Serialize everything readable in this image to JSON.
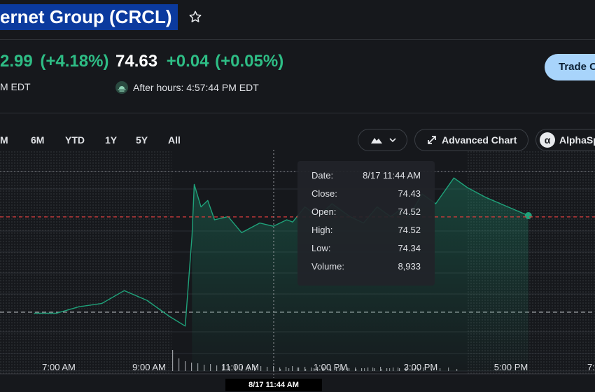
{
  "header": {
    "title": "ernet Group (CRCL)",
    "favorite_icon": "star-outline-icon"
  },
  "quote": {
    "regular_change_partial": "2.99",
    "regular_change_percent": "(+4.18%)",
    "regular_time_partial": "M EDT",
    "after_hours_price": "74.63",
    "after_hours_change": "+0.04",
    "after_hours_change_percent": "(+0.05%)",
    "after_hours_icon": "moon-sunset-icon",
    "after_hours_label": "After hours: 4:57:44 PM EDT"
  },
  "actions": {
    "trade_button": "Trade C"
  },
  "range_tabs": [
    "M",
    "6M",
    "YTD",
    "1Y",
    "5Y",
    "All"
  ],
  "toolbar": {
    "chart_type_icon": "mountain-chart-icon",
    "dropdown_icon": "chevron-down-icon",
    "advanced_chart_icon": "expand-arrows-icon",
    "advanced_chart_label": "Advanced Chart",
    "alphaspread_icon": "alpha-logo-icon",
    "alphaspread_label": "AlphaSp"
  },
  "tooltip": {
    "rows": [
      {
        "label": "Date:",
        "value": "8/17 11:44 AM"
      },
      {
        "label": "Close:",
        "value": "74.43"
      },
      {
        "label": "Open:",
        "value": "74.52"
      },
      {
        "label": "High:",
        "value": "74.52"
      },
      {
        "label": "Low:",
        "value": "74.34"
      },
      {
        "label": "Volume:",
        "value": "8,933"
      }
    ]
  },
  "crosshair_label": "8/17 11:44 AM",
  "colors": {
    "up": "#2ebd85",
    "reference_line": "#d63b3b",
    "highlight": "#0b3a9e",
    "trade_button": "#a8d4fb"
  },
  "chart_data": {
    "type": "area",
    "x_tick_labels": [
      "7:00 AM",
      "9:00 AM",
      "11:00 AM",
      "1:00 PM",
      "3:00 PM",
      "5:00 PM",
      "7:0"
    ],
    "x_hours": [
      6.0,
      6.5,
      7.0,
      7.5,
      8.0,
      8.5,
      9.0,
      9.35,
      9.5,
      9.55,
      9.7,
      9.85,
      10.0,
      10.3,
      10.6,
      11.0,
      11.3,
      11.6,
      11.73,
      12.0,
      12.3,
      12.6,
      13.0,
      13.3,
      13.6,
      13.9,
      14.1,
      14.3,
      14.6,
      14.9,
      15.3,
      15.6,
      16.0,
      16.5,
      16.95
    ],
    "price": [
      71.6,
      71.6,
      71.8,
      71.9,
      72.3,
      72.0,
      71.5,
      71.2,
      74.0,
      75.6,
      74.9,
      75.1,
      74.5,
      74.6,
      74.1,
      74.4,
      74.3,
      74.5,
      74.43,
      74.9,
      74.6,
      75.0,
      74.6,
      74.4,
      74.9,
      74.6,
      74.8,
      74.6,
      75.3,
      75.0,
      75.8,
      75.5,
      75.2,
      74.9,
      74.63
    ],
    "previous_close": 74.59,
    "grid": true
  }
}
